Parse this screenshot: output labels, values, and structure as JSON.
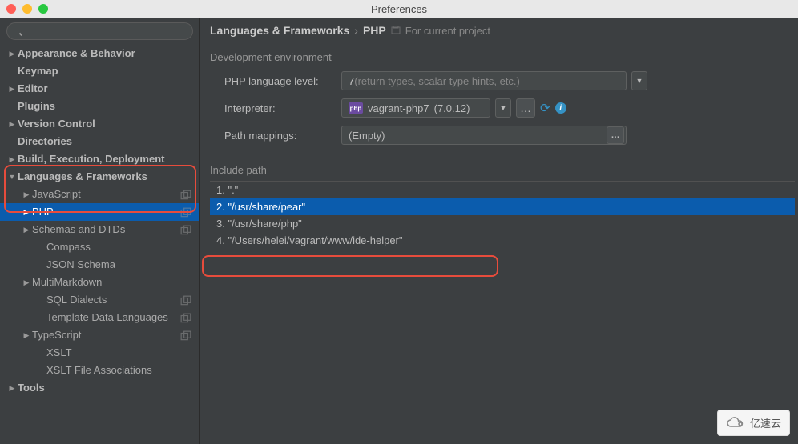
{
  "window": {
    "title": "Preferences"
  },
  "sidebar": {
    "search_placeholder": "",
    "items": [
      {
        "label": "Appearance & Behavior",
        "depth": 0,
        "arrow": "▶",
        "bold": true
      },
      {
        "label": "Keymap",
        "depth": 0,
        "arrow": "",
        "bold": true
      },
      {
        "label": "Editor",
        "depth": 0,
        "arrow": "▶",
        "bold": true
      },
      {
        "label": "Plugins",
        "depth": 0,
        "arrow": "",
        "bold": true
      },
      {
        "label": "Version Control",
        "depth": 0,
        "arrow": "▶",
        "bold": true
      },
      {
        "label": "Directories",
        "depth": 0,
        "arrow": "",
        "bold": true
      },
      {
        "label": "Build, Execution, Deployment",
        "depth": 0,
        "arrow": "▶",
        "bold": true
      },
      {
        "label": "Languages & Frameworks",
        "depth": 0,
        "arrow": "▼",
        "bold": true
      },
      {
        "label": "JavaScript",
        "depth": 1,
        "arrow": "▶",
        "bold": false,
        "copy": true
      },
      {
        "label": "PHP",
        "depth": 1,
        "arrow": "▶",
        "bold": false,
        "copy": true,
        "selected": true
      },
      {
        "label": "Schemas and DTDs",
        "depth": 1,
        "arrow": "▶",
        "bold": false,
        "copy": true
      },
      {
        "label": "Compass",
        "depth": 2,
        "arrow": "",
        "bold": false
      },
      {
        "label": "JSON Schema",
        "depth": 2,
        "arrow": "",
        "bold": false
      },
      {
        "label": "MultiMarkdown",
        "depth": 1,
        "arrow": "▶",
        "bold": false
      },
      {
        "label": "SQL Dialects",
        "depth": 2,
        "arrow": "",
        "bold": false,
        "copy": true
      },
      {
        "label": "Template Data Languages",
        "depth": 2,
        "arrow": "",
        "bold": false,
        "copy": true
      },
      {
        "label": "TypeScript",
        "depth": 1,
        "arrow": "▶",
        "bold": false,
        "copy": true
      },
      {
        "label": "XSLT",
        "depth": 2,
        "arrow": "",
        "bold": false
      },
      {
        "label": "XSLT File Associations",
        "depth": 2,
        "arrow": "",
        "bold": false
      },
      {
        "label": "Tools",
        "depth": 0,
        "arrow": "▶",
        "bold": true
      }
    ]
  },
  "breadcrumb": {
    "root": "Languages & Frameworks",
    "child": "PHP",
    "scope": "For current project"
  },
  "dev_env": {
    "title": "Development environment",
    "lang_label": "PHP language level:",
    "lang_value": "7",
    "lang_hint": " (return types, scalar type hints, etc.)",
    "interp_label": "Interpreter:",
    "interp_name": "vagrant-php7",
    "interp_version": " (7.0.12)",
    "interp_badge": "php",
    "path_label": "Path mappings:",
    "path_value": "(Empty)"
  },
  "include": {
    "title": "Include path",
    "items": [
      {
        "idx": "1.",
        "path": "\".\""
      },
      {
        "idx": "2.",
        "path": "\"/usr/share/pear\"",
        "selected": true
      },
      {
        "idx": "3.",
        "path": "\"/usr/share/php\""
      },
      {
        "idx": "4.",
        "path": "\"/Users/helei/vagrant/www/ide-helper\""
      }
    ]
  },
  "watermark": "亿速云"
}
